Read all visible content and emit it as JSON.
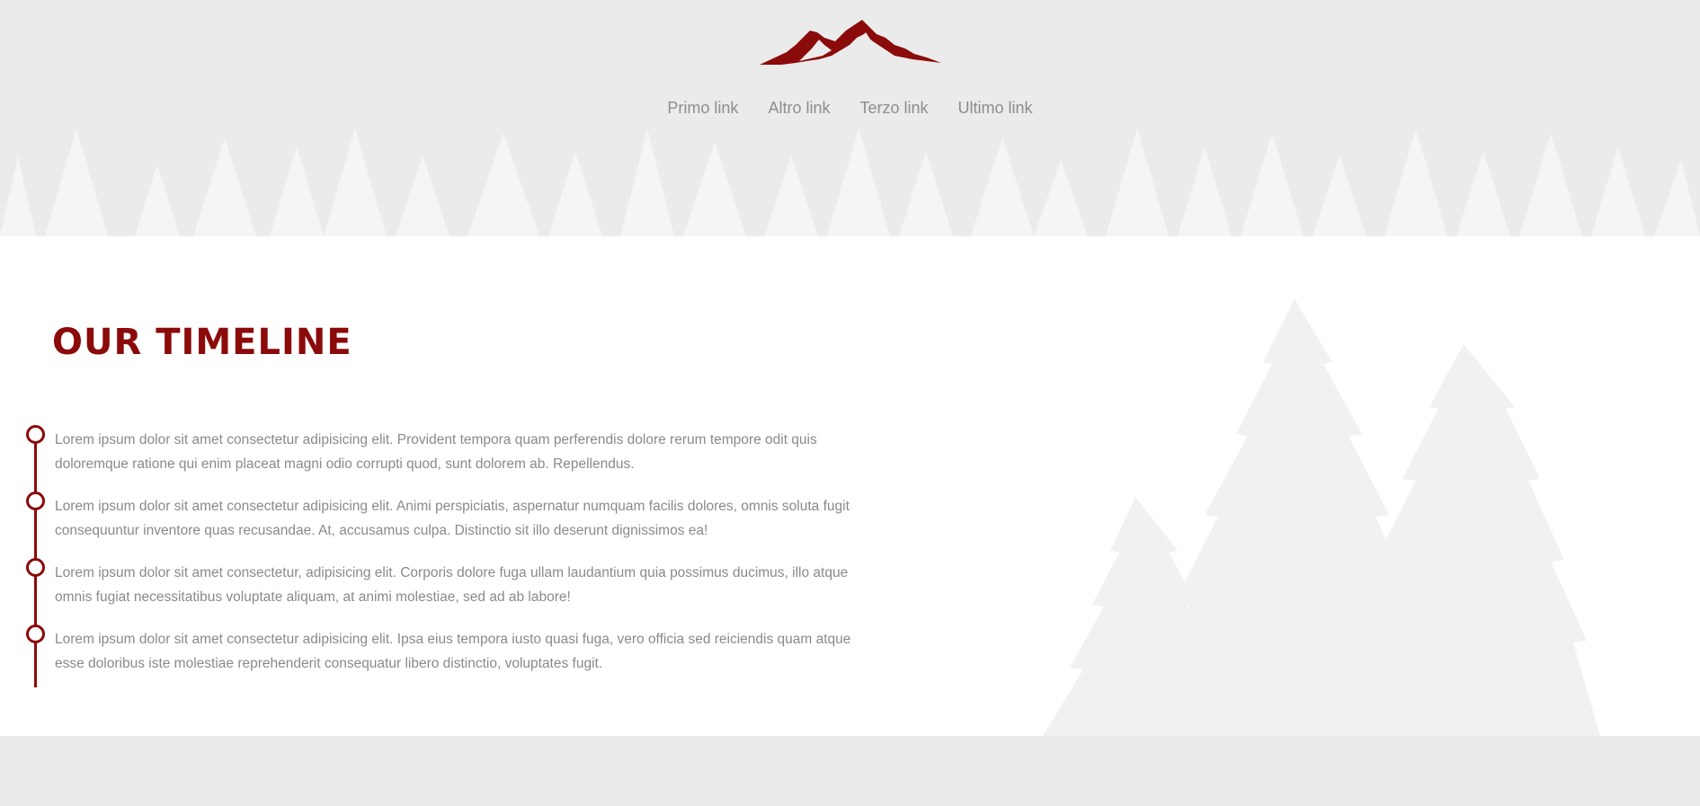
{
  "brand": {
    "logo_icon": "mountain-logo-icon",
    "color": "#8b0a0a"
  },
  "nav": {
    "links": [
      "Primo link",
      "Altro link",
      "Terzo link",
      "Ultimo link"
    ]
  },
  "timeline": {
    "title": "OUR TIMELINE",
    "items": [
      "Lorem ipsum dolor sit amet consectetur adipisicing elit. Provident tempora quam perferendis dolore rerum tempore odit quis doloremque ratione qui enim placeat magni odio corrupti quod, sunt dolorem ab. Repellendus.",
      "Lorem ipsum dolor sit amet consectetur adipisicing elit. Animi perspiciatis, aspernatur numquam facilis dolores, omnis soluta fugit consequuntur inventore quas recusandae. At, accusamus culpa. Distinctio sit illo deserunt dignissimos ea!",
      "Lorem ipsum dolor sit amet consectetur, adipisicing elit. Corporis dolore fuga ullam laudantium quia possimus ducimus, illo atque omnis fugiat necessitatibus voluptate aliquam, at animi molestiae, sed ad ab labore!",
      "Lorem ipsum dolor sit amet consectetur adipisicing elit. Ipsa eius tempora iusto quasi fuga, vero officia sed reiciendis quam atque esse doloribus iste molestiae reprehenderit consequatur libero distinctio, voluptates fugit."
    ]
  },
  "colors": {
    "accent": "#8b0a0a",
    "background": "#ebebeb",
    "text": "#8a8a8a",
    "tree": "#f3f3f3"
  }
}
